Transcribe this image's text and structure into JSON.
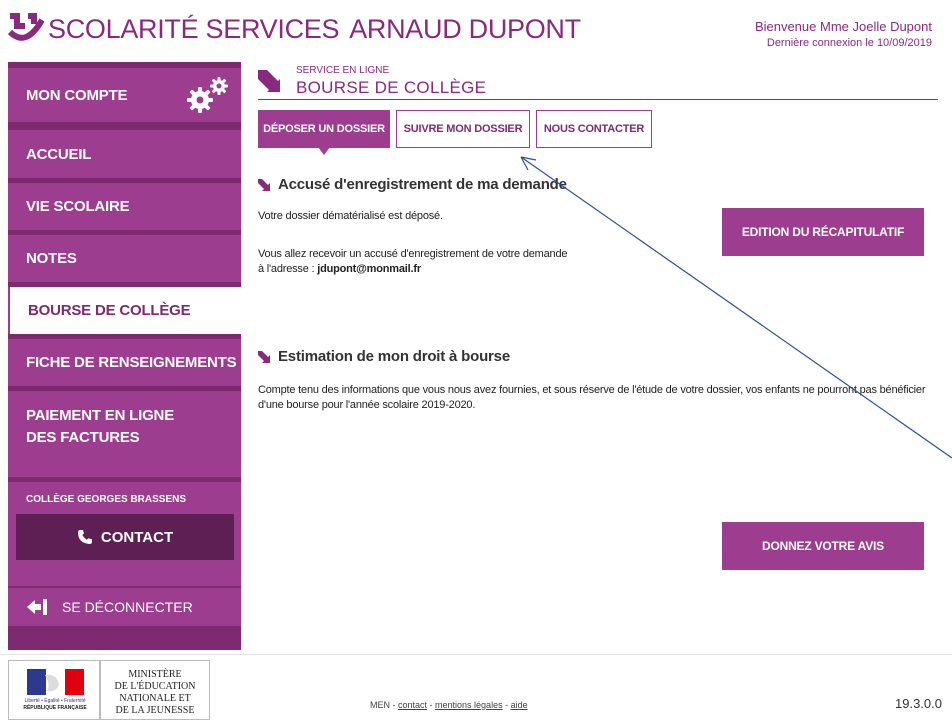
{
  "header": {
    "brand": "SCOLARITÉ SERVICES",
    "school_name": "ARNAUD DUPONT",
    "welcome": "Bienvenue Mme Joelle Dupont",
    "last_login": "Dernière connexion le 10/09/2019"
  },
  "sidebar": {
    "items": [
      {
        "label": "MON COMPTE"
      },
      {
        "label": "ACCUEIL"
      },
      {
        "label": "VIE SCOLAIRE"
      },
      {
        "label": "NOTES"
      },
      {
        "label": "BOURSE DE COLLÈGE"
      },
      {
        "label": "FICHE DE RENSEIGNEMENTS"
      },
      {
        "label": "PAIEMENT EN LIGNE DES FACTURES"
      }
    ],
    "college": "COLLÈGE GEORGES BRASSENS",
    "contact": "CONTACT",
    "logout": "SE DÉCONNECTER"
  },
  "service": {
    "small_label": "SERVICE EN LIGNE",
    "title": "BOURSE DE COLLÈGE"
  },
  "tabs": [
    {
      "label": "DÉPOSER UN DOSSIER",
      "active": true
    },
    {
      "label": "SUIVRE MON DOSSIER",
      "active": false
    },
    {
      "label": "NOUS CONTACTER",
      "active": false
    }
  ],
  "section1": {
    "title": "Accusé d'enregistrement de ma demande",
    "line1": "Votre dossier dématérialisé est déposé.",
    "line2a": "Vous allez recevoir un accusé d'enregistrement de votre demande",
    "line2b": "à l'adresse : ",
    "email": "jdupont@monmail.fr",
    "button": "EDITION DU RÉCAPITULATIF"
  },
  "section2": {
    "title": "Estimation de mon droit à bourse",
    "text_line1": "Compte tenu des informations que vous nous avez fournies, et sous réserve de l'étude de votre dossier, vos enfants ne pourront pas bénéficier",
    "text_line2": "d'une bourse pour l'année scolaire 2019-2020.",
    "button": "DONNEZ VOTRE AVIS"
  },
  "footer": {
    "ministry": [
      "MINISTÈRE",
      "DE L'ÉDUCATION",
      "NATIONALE ET",
      "DE LA JEUNESSE"
    ],
    "flag_motto": "Liberté • Égalité • Fraternité",
    "flag_rf": "RÉPUBLIQUE FRANÇAISE",
    "men": "MEN",
    "link_contact": "contact",
    "link_legal": "mentions légales",
    "link_help": "aide",
    "version": "19.3.0.0"
  },
  "colors": {
    "brand": "#8a2a7e",
    "sidebar_dark": "#7d2a71",
    "sidebar_item": "#9c3d8f",
    "annotation": "#2a4f9a"
  }
}
